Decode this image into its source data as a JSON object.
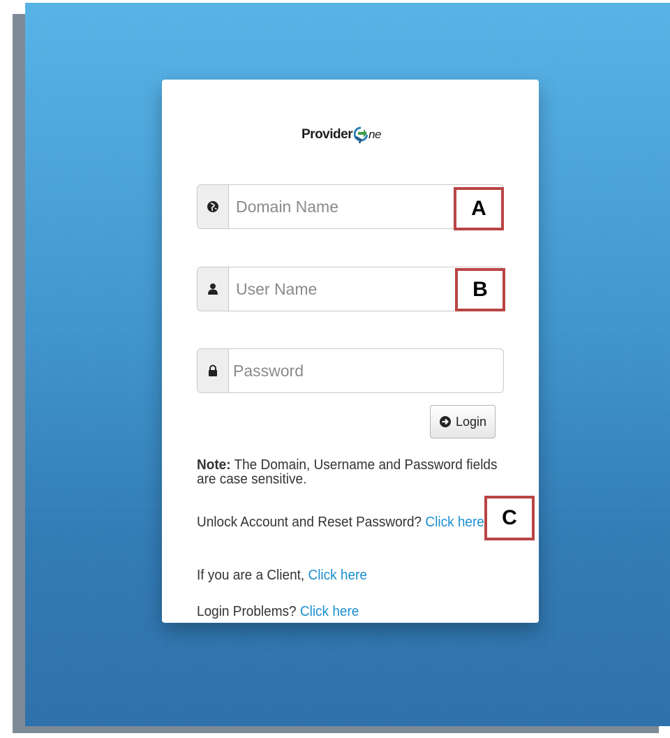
{
  "logo": {
    "word1": "Provider",
    "word2": "ne"
  },
  "fields": {
    "domain_placeholder": "Domain Name",
    "username_placeholder": "User Name",
    "password_placeholder": "Password"
  },
  "login_button": {
    "label": "Login"
  },
  "note": {
    "label": "Note:",
    "text": "The Domain, Username and Password fields are case sensitive."
  },
  "unlock": {
    "text": "Unlock Account and Reset Password? ",
    "link": "Click here"
  },
  "client": {
    "text": "If you are a Client, ",
    "link": "Click here"
  },
  "problems": {
    "text": "Login Problems? ",
    "link": "Click here"
  },
  "callouts": {
    "a": "A",
    "b": "B",
    "c": "C"
  },
  "colors": {
    "background_top": "#54b1e6",
    "background_bottom": "#2a6ea9",
    "link": "#1a8fd0",
    "callout_border": "#b94545"
  },
  "icons": {
    "domain": "globe-icon",
    "username": "user-icon",
    "password": "lock-icon",
    "login": "arrow-circle-right-icon"
  }
}
